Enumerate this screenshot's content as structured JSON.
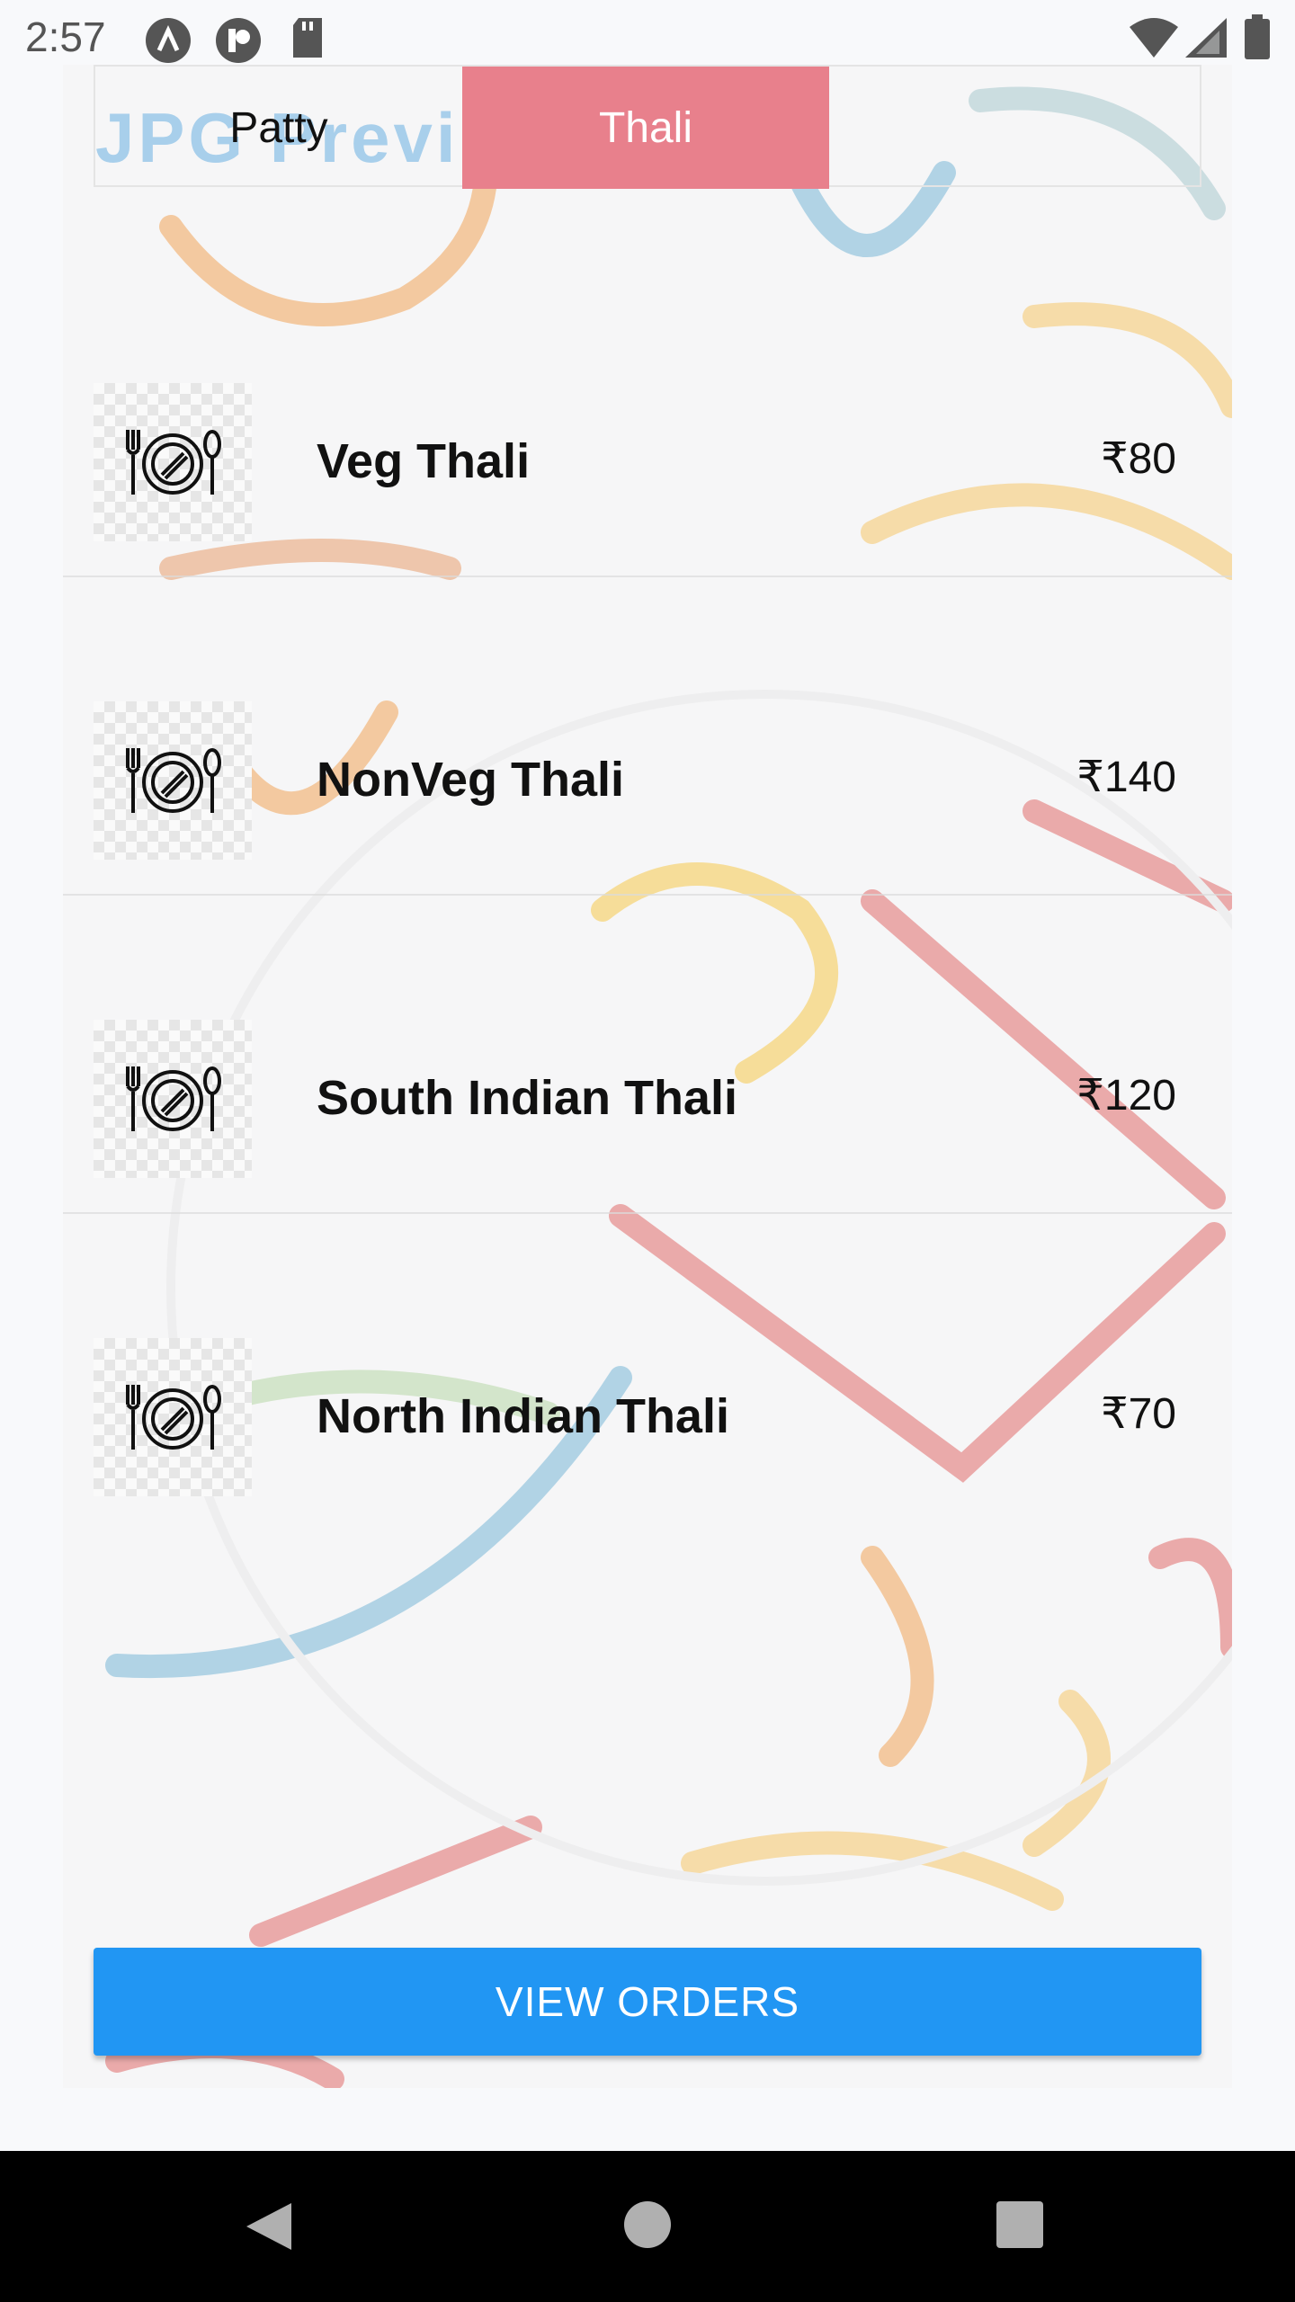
{
  "status_bar": {
    "time": "2:57",
    "icons": [
      "a-app-icon",
      "p-app-icon",
      "sd-card-icon",
      "wifi-icon",
      "signal-icon",
      "battery-icon"
    ]
  },
  "tabs": [
    {
      "label": "Patty",
      "selected": false
    },
    {
      "label": "Thali",
      "selected": true
    }
  ],
  "watermark": "JPG Previ",
  "items": [
    {
      "name": "Veg Thali",
      "price": "₹80",
      "icon": "plate-cutlery-icon"
    },
    {
      "name": "NonVeg Thali",
      "price": "₹140",
      "icon": "plate-cutlery-icon"
    },
    {
      "name": "South Indian Thali",
      "price": "₹120",
      "icon": "plate-cutlery-icon"
    },
    {
      "name": "North Indian Thali",
      "price": "₹70",
      "icon": "plate-cutlery-icon"
    }
  ],
  "view_orders_label": "VIEW ORDERS",
  "colors": {
    "tab_selected": "#e8808c",
    "button": "#2196f3",
    "navbar": "#000000"
  },
  "nav": [
    "back-icon",
    "home-icon",
    "recents-icon"
  ]
}
